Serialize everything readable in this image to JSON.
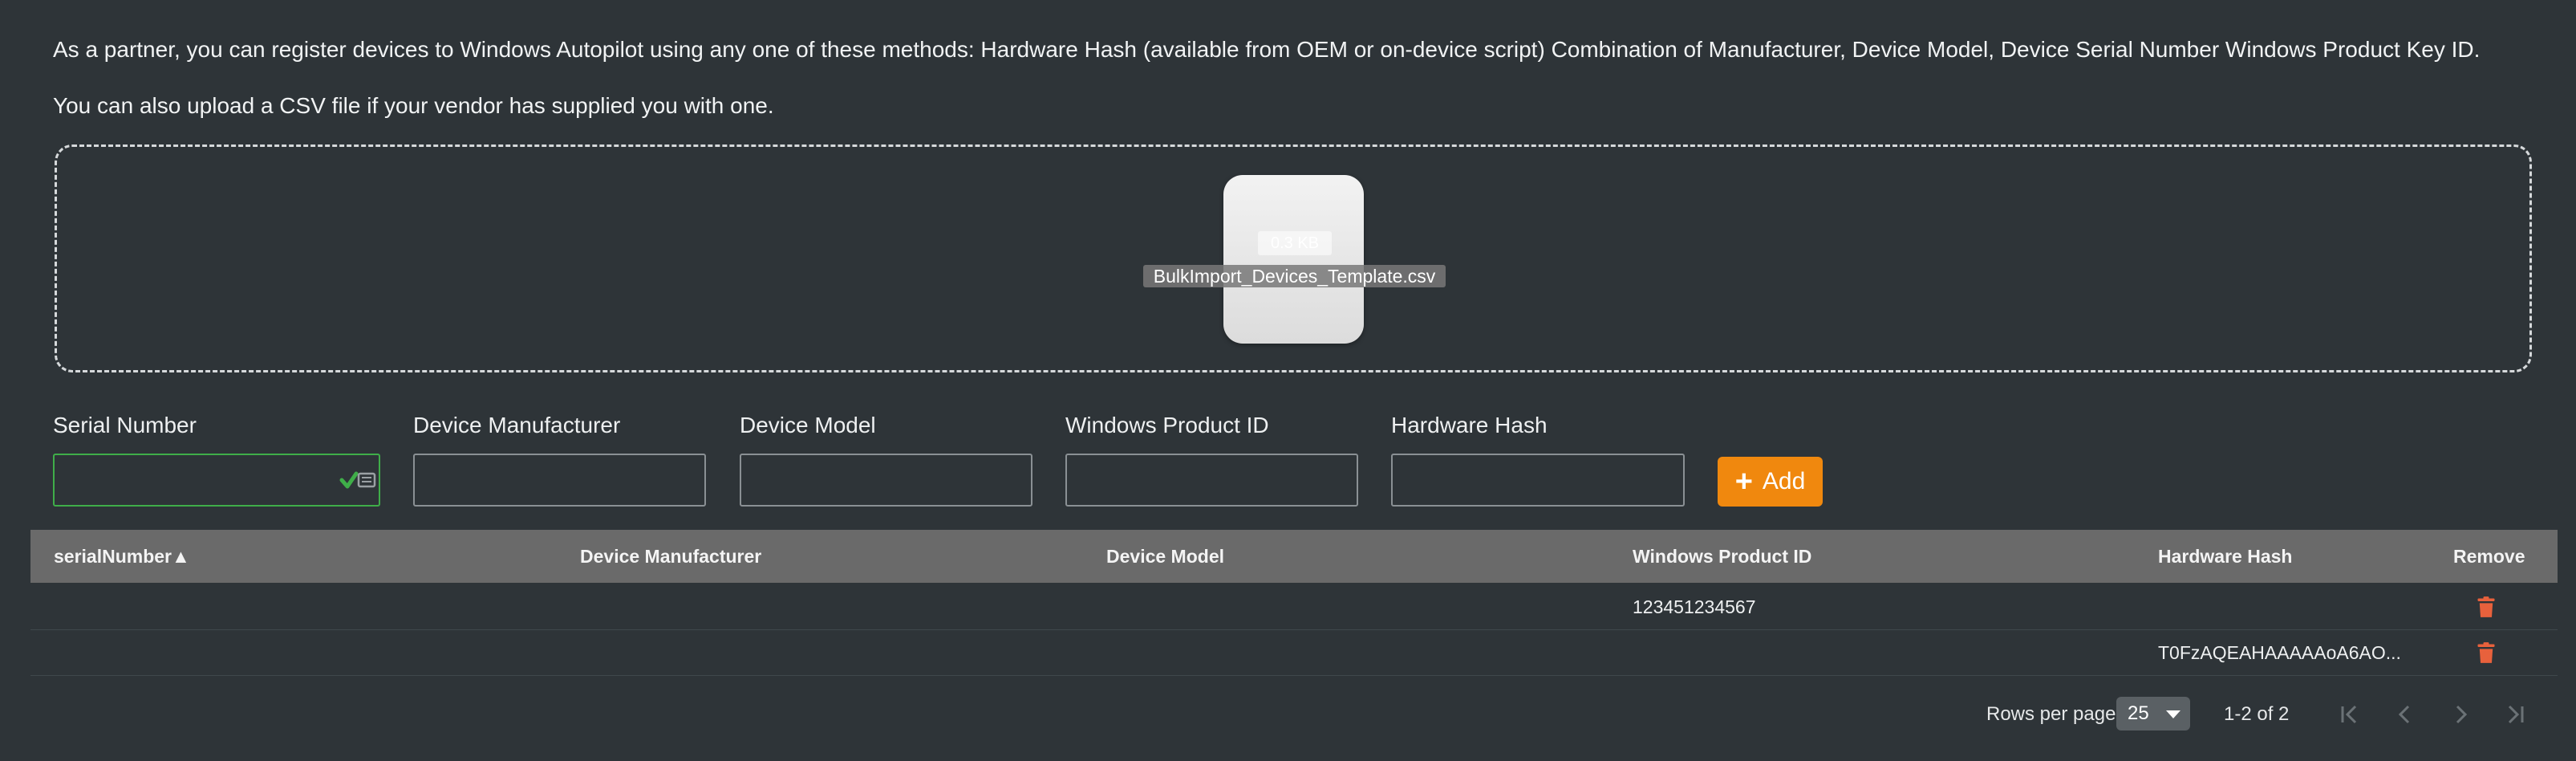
{
  "intro": {
    "line1": "As a partner, you can register devices to Windows Autopilot using any one of these methods: Hardware Hash (available from OEM or on-device script) Combination of Manufacturer, Device Model, Device Serial Number Windows Product Key ID.",
    "line2": "You can also upload a CSV file if your vendor has supplied you with one."
  },
  "dropzone": {
    "file_size": "0.3 KB",
    "file_name": "BulkImport_Devices_Template.csv"
  },
  "form": {
    "serial_label": "Serial Number",
    "manufacturer_label": "Device Manufacturer",
    "model_label": "Device Model",
    "product_id_label": "Windows Product ID",
    "hash_label": "Hardware Hash",
    "serial_value": "",
    "manufacturer_value": "",
    "model_value": "",
    "product_id_value": "",
    "hash_value": "",
    "add_label": "Add",
    "add_icon": "plus-icon",
    "accent_color": "#f0880e",
    "valid_color": "#3fae49"
  },
  "table": {
    "columns": [
      {
        "label": "serialNumber",
        "sort": "ascending"
      },
      {
        "label": "Device Manufacturer"
      },
      {
        "label": "Device Model"
      },
      {
        "label": "Windows Product ID"
      },
      {
        "label": "Hardware Hash"
      },
      {
        "label": "Remove"
      }
    ],
    "sort_icon": "▲",
    "rows": [
      {
        "serialNumber": "",
        "manufacturer": "",
        "model": "",
        "productId": "123451234567",
        "hardwareHash": ""
      },
      {
        "serialNumber": "",
        "manufacturer": "",
        "model": "",
        "productId": "",
        "hardwareHash": "T0FzAQEAHAAAAAoA6AO..."
      }
    ],
    "remove_icon": "trash-icon",
    "remove_color": "#e8613c"
  },
  "pagination": {
    "rows_per_page_label": "Rows per page:",
    "rows_per_page_value": "25",
    "range": "1-2 of 2"
  }
}
